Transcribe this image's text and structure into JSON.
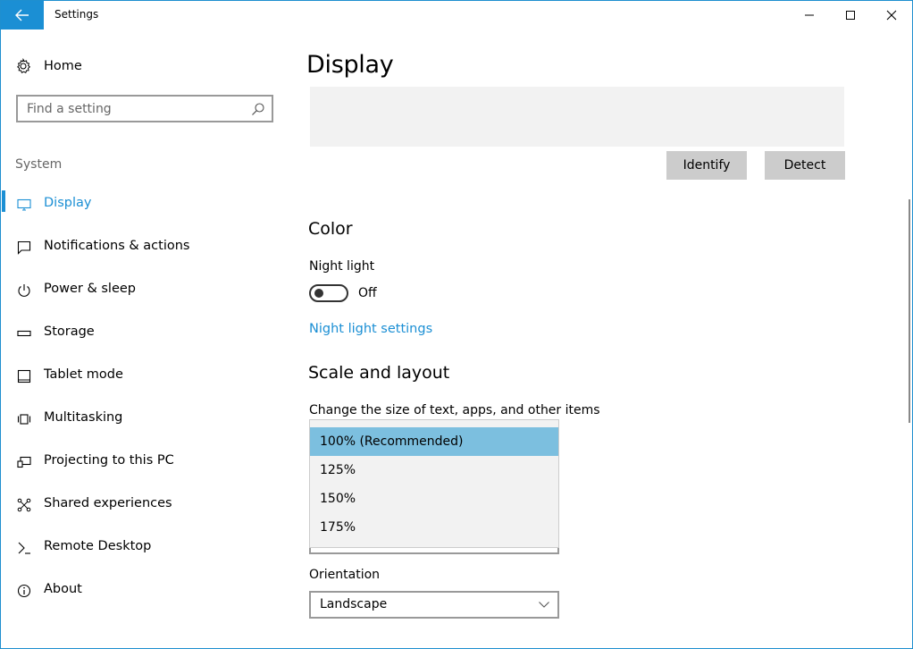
{
  "window": {
    "title": "Settings"
  },
  "sidebar": {
    "home_label": "Home",
    "search_placeholder": "Find a setting",
    "section_label": "System",
    "items": [
      {
        "label": "Display",
        "icon": "monitor-icon",
        "active": true
      },
      {
        "label": "Notifications & actions",
        "icon": "notification-icon",
        "active": false
      },
      {
        "label": "Power & sleep",
        "icon": "power-icon",
        "active": false
      },
      {
        "label": "Storage",
        "icon": "storage-icon",
        "active": false
      },
      {
        "label": "Tablet mode",
        "icon": "tablet-icon",
        "active": false
      },
      {
        "label": "Multitasking",
        "icon": "multitasking-icon",
        "active": false
      },
      {
        "label": "Projecting to this PC",
        "icon": "projecting-icon",
        "active": false
      },
      {
        "label": "Shared experiences",
        "icon": "share-icon",
        "active": false
      },
      {
        "label": "Remote Desktop",
        "icon": "remote-desktop-icon",
        "active": false
      },
      {
        "label": "About",
        "icon": "info-icon",
        "active": false
      }
    ]
  },
  "main": {
    "title": "Display",
    "identify_label": "Identify",
    "detect_label": "Detect",
    "color_heading": "Color",
    "night_light_label": "Night light",
    "night_light_state": "Off",
    "night_light_link": "Night light settings",
    "scale_heading": "Scale and layout",
    "scale_description": "Change the size of text, apps, and other items",
    "scale_options": [
      "100% (Recommended)",
      "125%",
      "150%",
      "175%"
    ],
    "scale_selected_index": 0,
    "orientation_label": "Orientation",
    "orientation_value": "Landscape"
  },
  "colors": {
    "accent": "#1b8fd4",
    "selected_option": "#7cbfdf",
    "button_bg": "#cccccc"
  }
}
